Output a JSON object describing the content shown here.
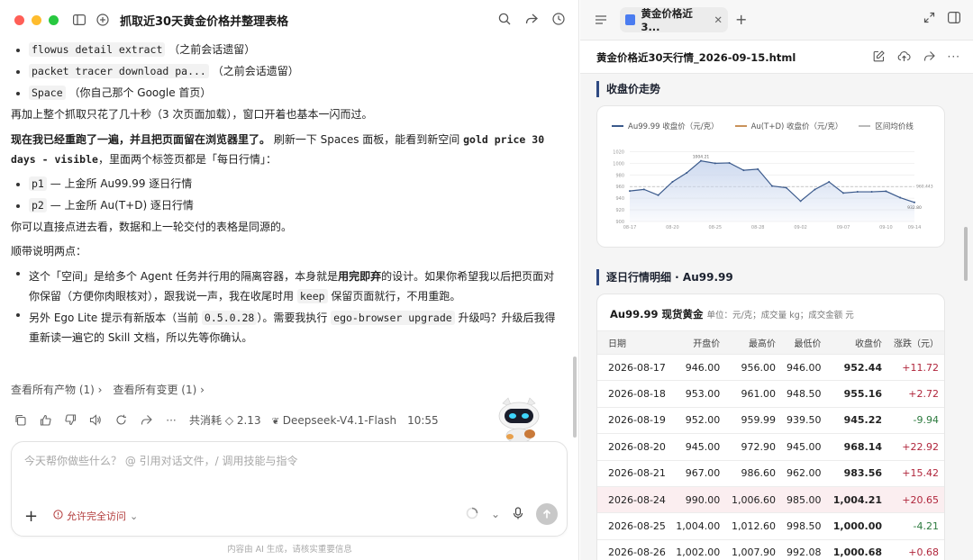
{
  "left": {
    "title": "抓取近30天黄金价格并整理表格",
    "bullets_top": [
      {
        "code": "flowus detail extract",
        "note": "（之前会话遗留）"
      },
      {
        "code": "packet tracer download pa...",
        "note": "（之前会话遗留）"
      },
      {
        "code": "Space",
        "note": "（你自己那个 Google 首页）"
      }
    ],
    "para1": "再加上整个抓取只花了几十秒（3 次页面加载），窗口开着也基本一闪而过。",
    "para2_bold": "现在我已经重跑了一遍，并且把页面留在浏览器里了。",
    "para2_mid": "刷新一下 Spaces 面板，能看到新空间",
    "para2_code": "gold price 30 days - visible",
    "para2_tail": "，里面两个标签页都是「每日行情」：",
    "bullets_mid": [
      {
        "code": "p1",
        "text": "— 上金所 Au99.99 逐日行情"
      },
      {
        "code": "p2",
        "text": "— 上金所 Au(T+D) 逐日行情"
      }
    ],
    "para3": "你可以直接点进去看，数据和上一轮交付的表格是同源的。",
    "para4": "顺带说明两点：",
    "note1_a": "这个「空间」是给多个 Agent 任务并行用的隔离容器，本身就是",
    "note1_b": "用完即弃",
    "note1_c": "的设计。如果你希望我以后把页面对你保留（方便你肉眼核对），跟我说一声，我在收尾时用",
    "note1_code": "keep",
    "note1_d": "保留页面就行，不用重跑。",
    "note2_a": "另外 Ego Lite 提示有新版本（当前",
    "note2_ver": "0.5.0.28",
    "note2_b": "）。需要我执行",
    "note2_cmd": "ego-browser upgrade",
    "note2_c": "升级吗？升级后我得重新读一遍它的 Skill 文档，所以先等你确认。",
    "link_artifacts": "查看所有产物 (1)",
    "link_changes": "查看所有变更 (1)",
    "cost": "共消耗 ◇ 2.13",
    "model": "Deepseek-V4.1-Flash",
    "time": "10:55",
    "composer_placeholder": "今天帮你做些什么？ @ 引用对话文件，/ 调用技能与指令",
    "permission": "允许完全访问",
    "footnote": "内容由 AI 生成，请核实重要信息"
  },
  "right": {
    "tab_label": "黄金价格近3...",
    "file_name": "黄金价格近30天行情_2026-09-15.html",
    "section_trend": "收盘价走势",
    "section_detail": "逐日行情明细 · Au99.99",
    "table_title": "Au99.99 现货黄金",
    "table_unit": "单位：元/克；成交量 kg；成交金额 元",
    "columns": [
      "日期",
      "开盘价",
      "最高价",
      "最低价",
      "收盘价",
      "涨跌（元）"
    ],
    "rows": [
      [
        "2026-08-17",
        "946.00",
        "956.00",
        "946.00",
        "952.44",
        "+11.72"
      ],
      [
        "2026-08-18",
        "953.00",
        "961.00",
        "948.50",
        "955.16",
        "+2.72"
      ],
      [
        "2026-08-19",
        "952.00",
        "959.99",
        "939.50",
        "945.22",
        "-9.94"
      ],
      [
        "2026-08-20",
        "945.00",
        "972.90",
        "945.00",
        "968.14",
        "+22.92"
      ],
      [
        "2026-08-21",
        "967.00",
        "986.60",
        "962.00",
        "983.56",
        "+15.42"
      ],
      [
        "2026-08-24",
        "990.00",
        "1,006.60",
        "985.00",
        "1,004.21",
        "+20.65"
      ],
      [
        "2026-08-25",
        "1,004.00",
        "1,012.60",
        "998.50",
        "1,000.00",
        "-4.21"
      ],
      [
        "2026-08-26",
        "1,002.00",
        "1,007.90",
        "992.08",
        "1,000.68",
        "+0.68"
      ]
    ],
    "highlight_row": 5
  },
  "chart_data": {
    "type": "line",
    "title": "",
    "xlabel": "",
    "ylabel": "",
    "x": [
      "08-17",
      "08-18",
      "08-19",
      "08-20",
      "08-21",
      "08-24",
      "08-25",
      "08-26",
      "08-27",
      "08-28",
      "08-31",
      "09-01",
      "09-02",
      "09-03",
      "09-04",
      "09-07",
      "09-08",
      "09-09",
      "09-10",
      "09-11",
      "09-14"
    ],
    "x_ticks": [
      "08-17",
      "08-20",
      "08-25",
      "08-28",
      "09-02",
      "09-07",
      "09-10",
      "09-14"
    ],
    "y_ticks": [
      900,
      920,
      940,
      960,
      980,
      1000,
      1020
    ],
    "ylim": [
      900,
      1030
    ],
    "series": [
      {
        "name": "Au99.99 收盘价（元/克）",
        "color": "#3b5a8c",
        "values": [
          952.44,
          955.16,
          945.22,
          968.14,
          983.56,
          1004.21,
          1000.0,
          1000.68,
          988.0,
          990.0,
          961.0,
          958.0,
          935.0,
          955.0,
          968.0,
          949.0,
          951.0,
          951.0,
          952.0,
          941.0,
          932.8
        ]
      },
      {
        "name": "Au(T+D) 收盘价（元/克）",
        "color": "#c9925a",
        "values": []
      },
      {
        "name": "区间均价线",
        "color": "#b9b9b9",
        "values": [
          960.0
        ]
      }
    ],
    "annotations": [
      {
        "label": "1004.21"
      },
      {
        "label": "960.443"
      },
      {
        "label": "932.80"
      }
    ],
    "grid": true,
    "legend": "top"
  }
}
